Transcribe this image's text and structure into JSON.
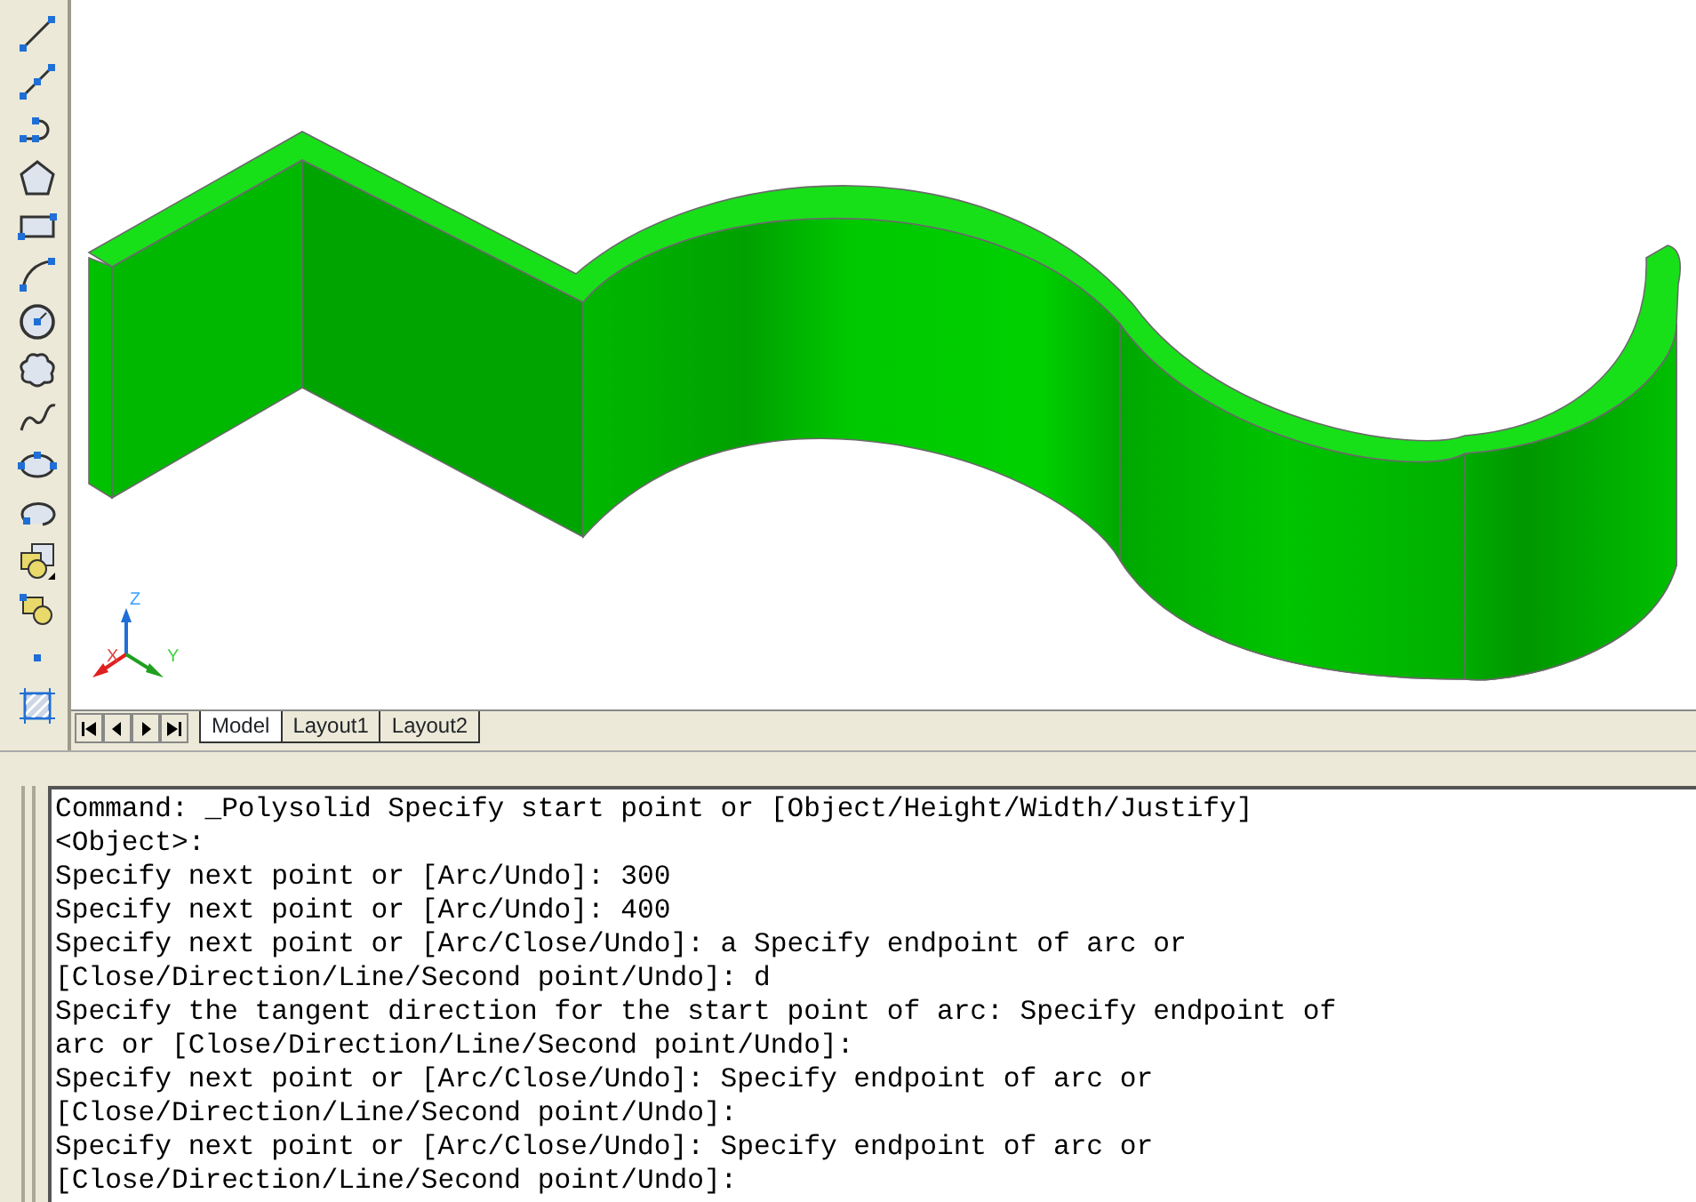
{
  "ucs": {
    "z_label": "Z",
    "y_label": "Y",
    "x_label": "X"
  },
  "tabs": [
    {
      "label": "Model",
      "selected": true
    },
    {
      "label": "Layout1",
      "selected": false
    },
    {
      "label": "Layout2",
      "selected": false
    }
  ],
  "command_lines": [
    "Command: _Polysolid Specify start point or [Object/Height/Width/Justify]",
    "<Object>:",
    "Specify next point or [Arc/Undo]: 300",
    "Specify next point or [Arc/Undo]: 400",
    "Specify next point or [Arc/Close/Undo]: a Specify endpoint of arc or",
    "[Close/Direction/Line/Second point/Undo]: d",
    "Specify the tangent direction for the start point of arc: Specify endpoint of",
    "arc or [Close/Direction/Line/Second point/Undo]:",
    "Specify next point or [Arc/Close/Undo]: Specify endpoint of arc or",
    "[Close/Direction/Line/Second point/Undo]:",
    "Specify next point or [Arc/Close/Undo]: Specify endpoint of arc or",
    "[Close/Direction/Line/Second point/Undo]:"
  ]
}
